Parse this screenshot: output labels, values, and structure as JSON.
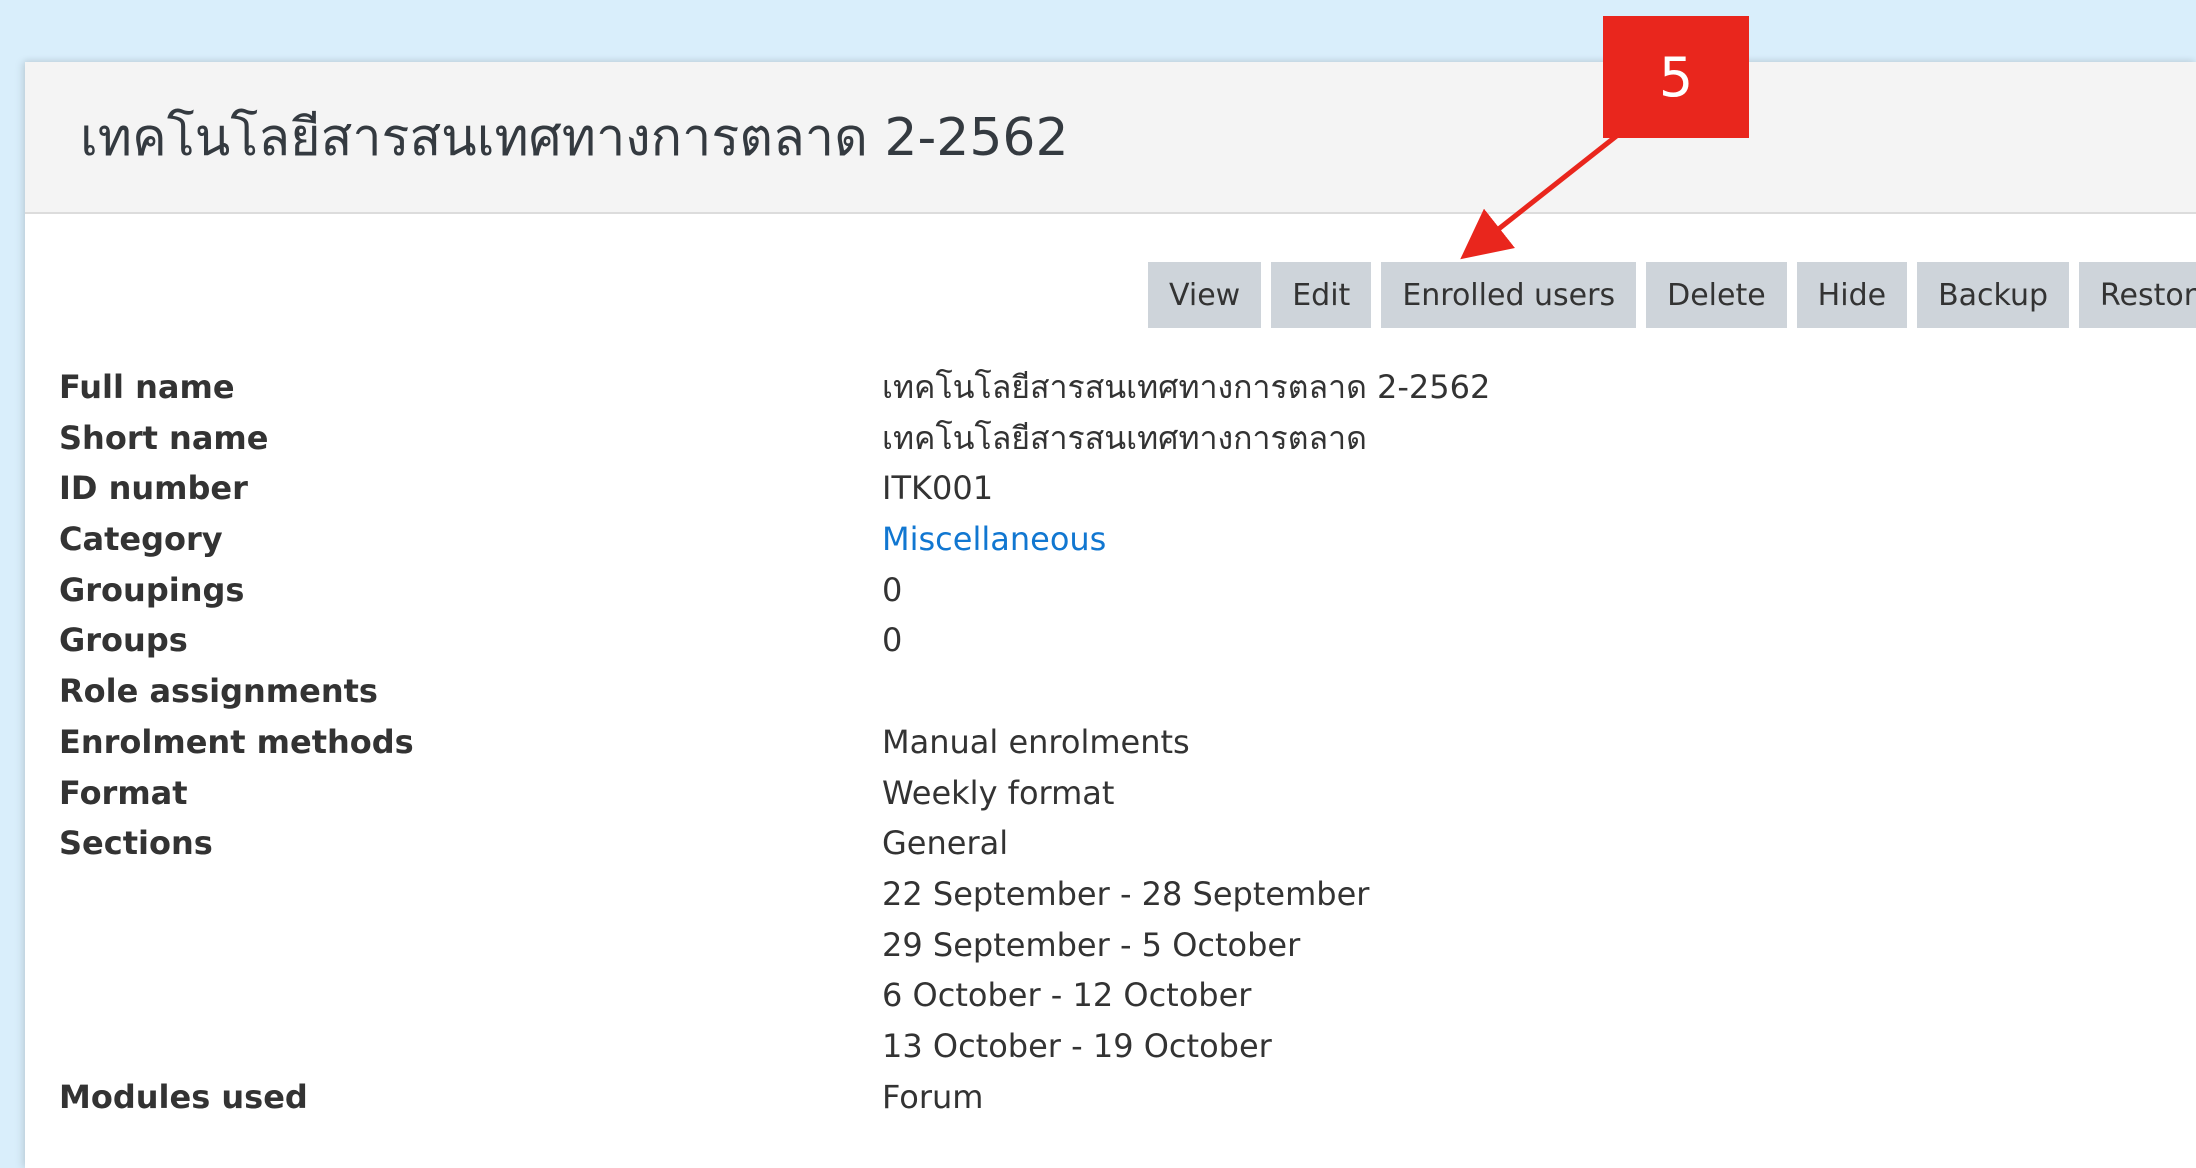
{
  "course": {
    "title": "เทคโนโลยีสารสนเทศทางการตลาด 2-2562"
  },
  "actions": {
    "view": "View",
    "edit": "Edit",
    "enrolled_users": "Enrolled users",
    "delete": "Delete",
    "hide": "Hide",
    "backup": "Backup",
    "restore": "Restore"
  },
  "details": {
    "full_name": {
      "label": "Full name",
      "value": "เทคโนโลยีสารสนเทศทางการตลาด 2-2562"
    },
    "short_name": {
      "label": "Short name",
      "value": "เทคโนโลยีสารสนเทศทางการตลาด"
    },
    "id_number": {
      "label": "ID number",
      "value": "ITK001"
    },
    "category": {
      "label": "Category",
      "value": "Miscellaneous"
    },
    "groupings": {
      "label": "Groupings",
      "value": "0"
    },
    "groups": {
      "label": "Groups",
      "value": "0"
    },
    "role_assignments": {
      "label": "Role assignments",
      "value": ""
    },
    "enrolment_methods": {
      "label": "Enrolment methods",
      "value": "Manual enrolments"
    },
    "format": {
      "label": "Format",
      "value": "Weekly format"
    },
    "sections": {
      "label": "Sections",
      "values": [
        "General",
        "22 September - 28 September",
        "29 September - 5 October",
        "6 October - 12 October",
        "13 October - 19 October"
      ]
    },
    "modules_used": {
      "label": "Modules used",
      "value": "Forum"
    }
  },
  "annotation": {
    "step_number": "5",
    "color": "#e9261d"
  },
  "colors": {
    "background": "#d9eefb",
    "button": "#ced4da",
    "link": "#1177d1"
  }
}
